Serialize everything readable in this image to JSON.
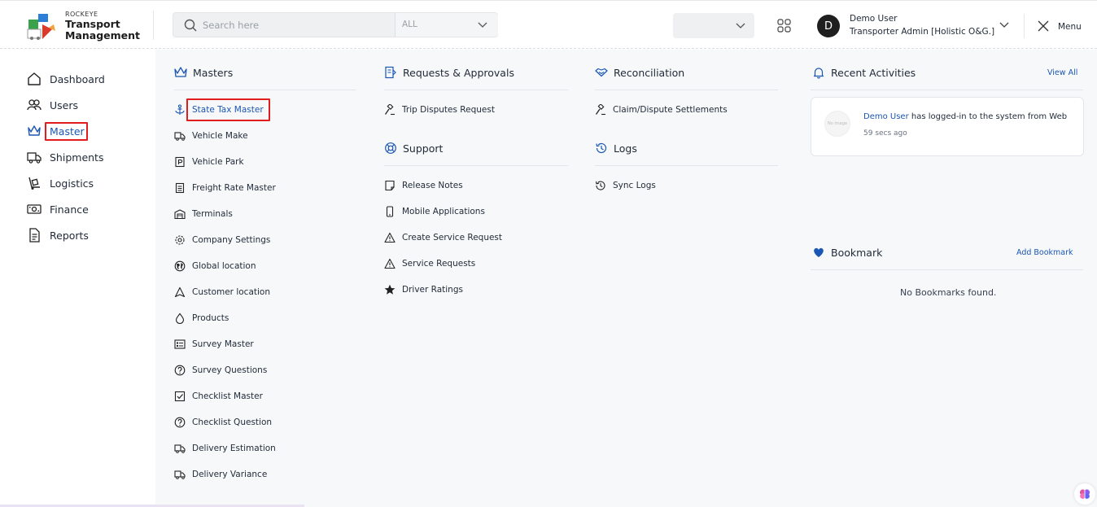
{
  "brand": {
    "small": "ROCKEYE",
    "line1": "Transport",
    "line2": "Management"
  },
  "search": {
    "placeholder": "Search here",
    "scope": "ALL"
  },
  "user": {
    "initial": "D",
    "name": "Demo User",
    "role": "Transporter Admin [Holistic O&G.]"
  },
  "header": {
    "menu_label": "Menu"
  },
  "sidebar": {
    "items": [
      {
        "label": "Dashboard",
        "icon": "home-icon"
      },
      {
        "label": "Users",
        "icon": "users-icon"
      },
      {
        "label": "Master",
        "icon": "crown-icon",
        "active": true
      },
      {
        "label": "Shipments",
        "icon": "truck-icon"
      },
      {
        "label": "Logistics",
        "icon": "dolly-icon"
      },
      {
        "label": "Finance",
        "icon": "money-icon"
      },
      {
        "label": "Reports",
        "icon": "report-icon"
      }
    ]
  },
  "masters": {
    "title": "Masters",
    "items": [
      "State Tax Master",
      "Vehicle Make",
      "Vehicle Park",
      "Freight Rate Master",
      "Terminals",
      "Company Settings",
      "Global location",
      "Customer location",
      "Products",
      "Survey Master",
      "Survey Questions",
      "Checklist Master",
      "Checklist Question",
      "Delivery Estimation",
      "Delivery Variance"
    ]
  },
  "requests": {
    "title": "Requests & Approvals",
    "items": [
      "Trip Disputes Request"
    ]
  },
  "support": {
    "title": "Support",
    "items": [
      "Release Notes",
      "Mobile Applications",
      "Create Service Request",
      "Service Requests",
      "Driver Ratings"
    ]
  },
  "reconciliation": {
    "title": "Reconciliation",
    "items": [
      "Claim/Dispute Settlements"
    ]
  },
  "logs": {
    "title": "Logs",
    "items": [
      "Sync Logs"
    ]
  },
  "recent": {
    "title": "Recent Activities",
    "view_all": "View All",
    "activity": {
      "user": "Demo User",
      "text": " has logged-in to the system from Web",
      "time": "59 secs ago",
      "image_alt": "No image"
    }
  },
  "bookmark": {
    "title": "Bookmark",
    "add": "Add Bookmark",
    "empty": "No Bookmarks found."
  },
  "colors": {
    "accent": "#1a56b3",
    "highlight": "#e11d1d"
  }
}
